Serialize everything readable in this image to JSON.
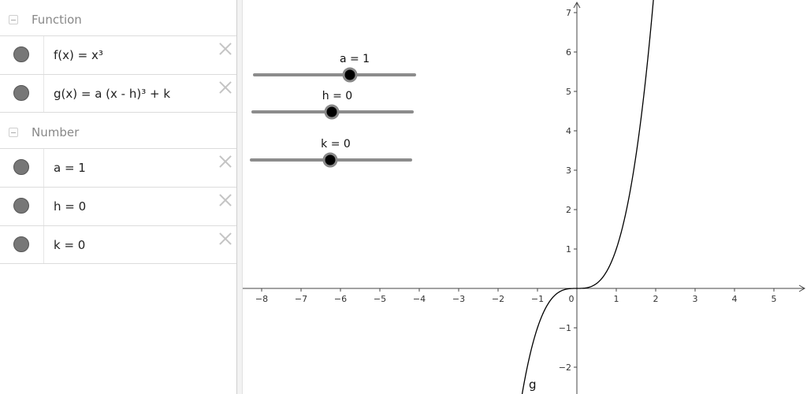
{
  "algebra": {
    "categories": [
      {
        "label": "Function"
      },
      {
        "label": "Number"
      }
    ],
    "function_items": [
      {
        "expr": "f(x) = x³"
      },
      {
        "expr": "g(x) = a (x - h)³ + k"
      }
    ],
    "number_items": [
      {
        "expr": "a = 1"
      },
      {
        "expr": "h = 0"
      },
      {
        "expr": "k = 0"
      }
    ]
  },
  "sliders": [
    {
      "label": "a = 1",
      "value": 1,
      "min": -5,
      "max": 5
    },
    {
      "label": "h = 0",
      "value": 0,
      "min": -5,
      "max": 5
    },
    {
      "label": "k = 0",
      "value": 0,
      "min": -5,
      "max": 5
    }
  ],
  "graph": {
    "x_ticks": [
      "−8",
      "−7",
      "−6",
      "−5",
      "−4",
      "−3",
      "−2",
      "−1",
      "0",
      "1",
      "2",
      "3",
      "4",
      "5"
    ],
    "y_ticks": [
      "7",
      "6",
      "5",
      "4",
      "3",
      "2",
      "1",
      "−1",
      "−2"
    ],
    "curve_label": "g",
    "curve_color": "#000000"
  }
}
